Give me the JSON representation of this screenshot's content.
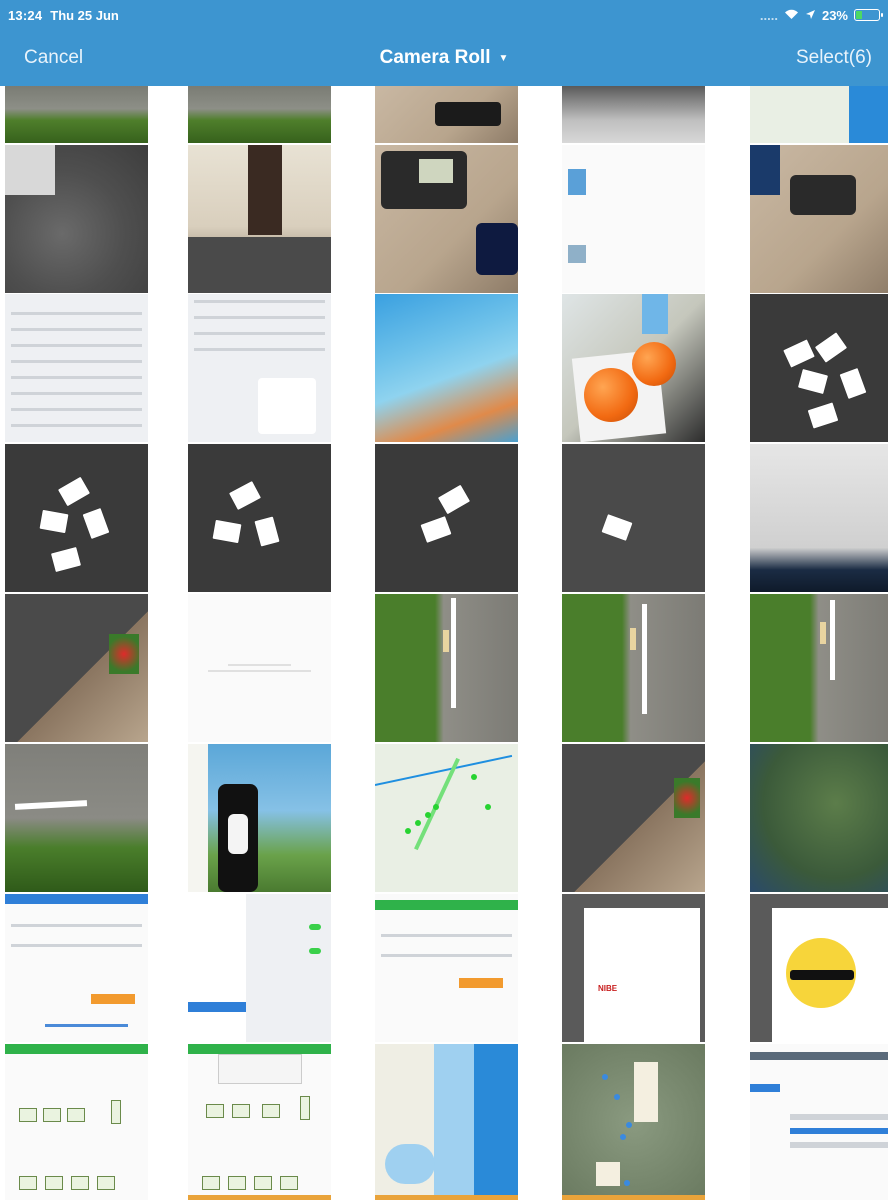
{
  "status_bar": {
    "time": "13:24",
    "date": "Thu 25 Jun",
    "signal": ".....",
    "battery_text": "23%",
    "battery_level": 0.23
  },
  "nav": {
    "cancel_label": "Cancel",
    "title": "Camera Roll",
    "select_label": "Select(6)"
  },
  "colors": {
    "nav_bg": "#3d95d0",
    "battery_fill": "#4cd964"
  },
  "grid": {
    "columns": 5,
    "rows": 8,
    "thumbnails": [
      "grass-edge",
      "grass-edge",
      "phone-charging",
      "keyboard-desk",
      "map-screenshot",
      "carpet-chair",
      "office-door",
      "desk-phone",
      "document-screenshot",
      "desk-phone",
      "settings-screenshot",
      "settings-menu-screenshot",
      "ios-wallpaper",
      "oranges",
      "paper-pieces",
      "paper-pieces",
      "paper-pieces",
      "paper-pieces",
      "paper-piece",
      "monitor-screen",
      "floor-flowers",
      "empty-screenshot",
      "road-grass",
      "road-grass",
      "road-grass",
      "road-grass",
      "cow-painting",
      "map-route",
      "floor-flowers",
      "satellite-map",
      "app-screenshot",
      "ipad-settings",
      "app-screenshot",
      "app-dialog",
      "app-dialog-sun",
      "app-houses",
      "app-houses",
      "map-coast",
      "satellite-pins",
      "table-screenshot"
    ]
  }
}
